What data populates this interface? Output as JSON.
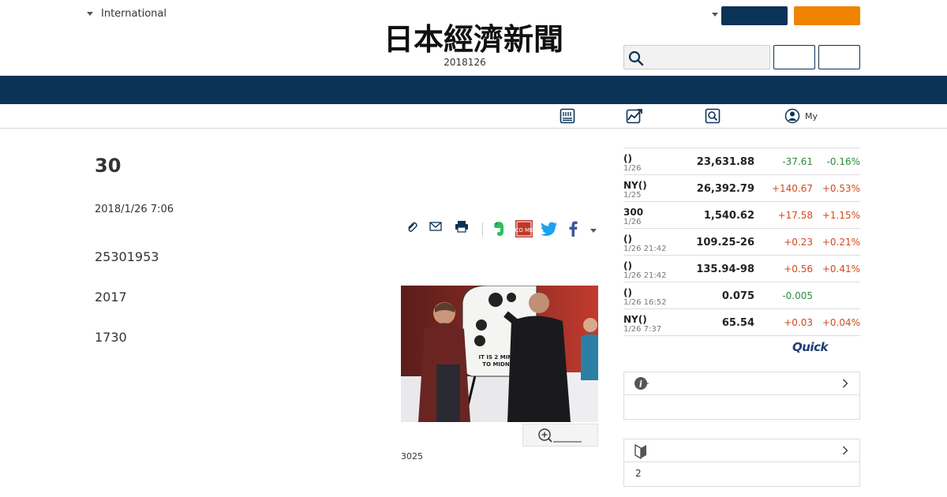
{
  "header": {
    "region_label": "International",
    "logo_text": "日本經濟新聞",
    "edition_date": "2018126",
    "search_placeholder": ""
  },
  "subnav": {
    "my_label": "My"
  },
  "article": {
    "title": "30",
    "date": "2018/1/26 7:06",
    "paragraphs": [
      "25301953",
      "2017",
      "1730"
    ],
    "photo_caption": "3025",
    "photo_sign_line1": "IT IS 2 MINUTES",
    "photo_sign_line2": "TO MIDNIGHT",
    "share_come_label": "CO ME"
  },
  "market": {
    "rows": [
      {
        "name": "()",
        "time": "1/26",
        "value": "23,631.88",
        "change": "-37.61",
        "pct": "-0.16%",
        "dir": "down"
      },
      {
        "name": "NY()",
        "time": "1/25",
        "value": "26,392.79",
        "change": "+140.67",
        "pct": "+0.53%",
        "dir": "up"
      },
      {
        "name": "300",
        "time": "1/26",
        "value": "1,540.62",
        "change": "+17.58",
        "pct": "+1.15%",
        "dir": "up"
      },
      {
        "name": "()",
        "time": "1/26 21:42",
        "value": "109.25-26",
        "change": "+0.23",
        "pct": "+0.21%",
        "dir": "up"
      },
      {
        "name": "()",
        "time": "1/26 21:42",
        "value": "135.94-98",
        "change": "+0.56",
        "pct": "+0.41%",
        "dir": "up"
      },
      {
        "name": "()",
        "time": "1/26 16:52",
        "value": "0.075",
        "change": "-0.005",
        "pct": "",
        "dir": "down"
      },
      {
        "name": "NY()",
        "time": "1/26 7:37",
        "value": "65.54",
        "change": "+0.03",
        "pct": "+0.04%",
        "dir": "up"
      }
    ],
    "provider_logo": "Quick"
  },
  "panels": {
    "info_body": "",
    "beginner_body": "2"
  },
  "colors": {
    "navy": "#0b3357",
    "orange": "#f08300",
    "up": "#d2491c",
    "down": "#2e8b3a"
  }
}
